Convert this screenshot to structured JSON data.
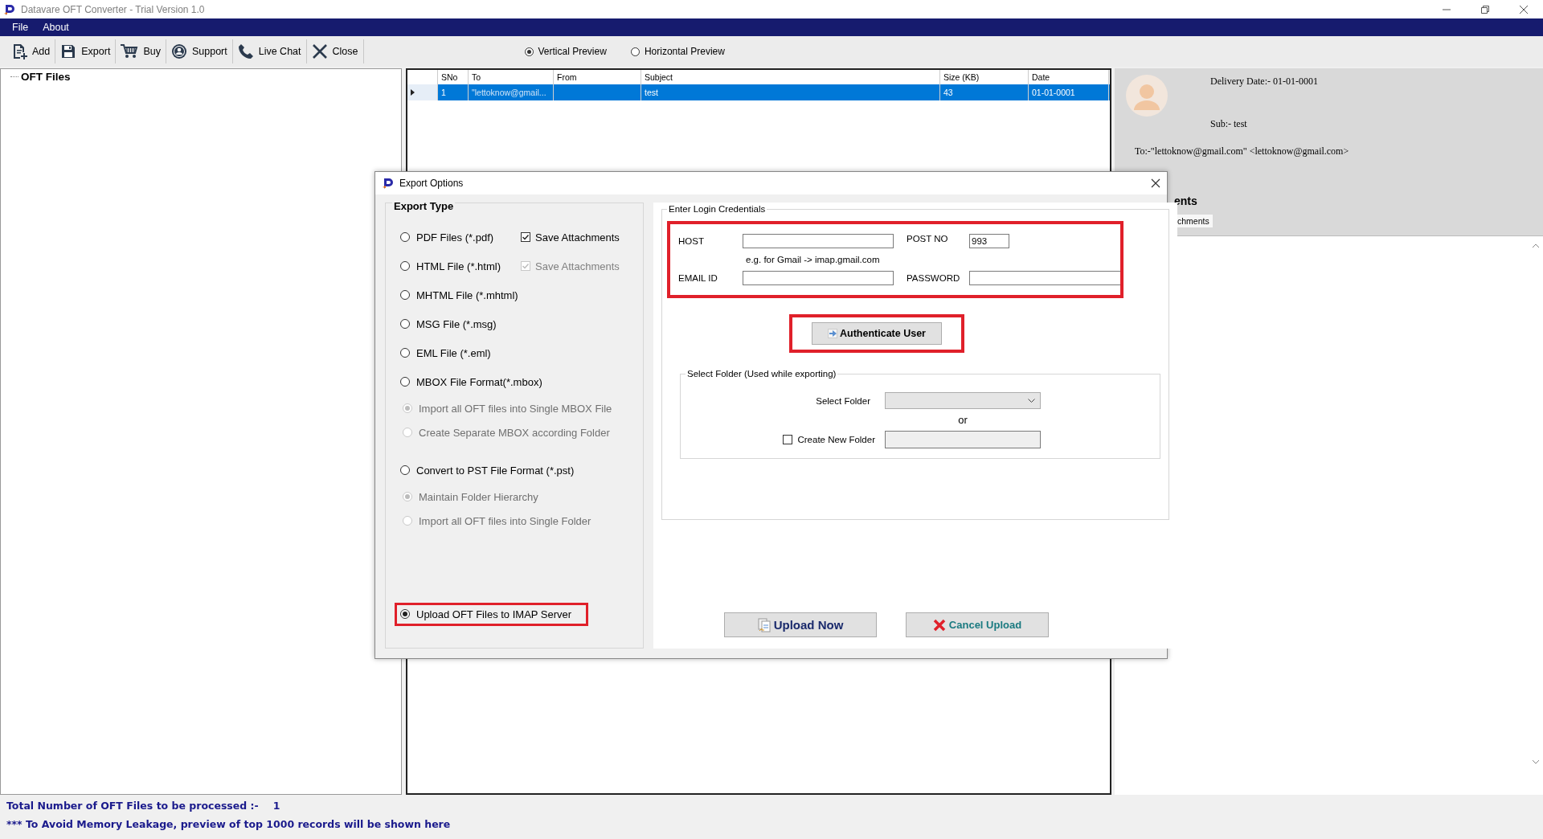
{
  "window": {
    "title": "Datavare OFT Converter - Trial Version 1.0"
  },
  "menu": [
    "File",
    "About"
  ],
  "toolbar": [
    {
      "label": "Add"
    },
    {
      "label": "Export"
    },
    {
      "label": "Buy"
    },
    {
      "label": "Support"
    },
    {
      "label": "Live Chat"
    },
    {
      "label": "Close"
    }
  ],
  "preview_mode": [
    {
      "label": "Vertical Preview",
      "selected": true
    },
    {
      "label": "Horizontal Preview",
      "selected": false
    }
  ],
  "tree": {
    "root": "OFT Files"
  },
  "grid": {
    "columns": [
      "SNo",
      "To",
      "From",
      "Subject",
      "Size (KB)",
      "Date"
    ],
    "rows": [
      {
        "selected": true,
        "sno": "1",
        "to": "\"lettoknow@gmail...",
        "subject": "test",
        "size": "43",
        "date": "01-01-0001"
      }
    ]
  },
  "preview": {
    "delivery_date": "Delivery Date:- 01-01-0001",
    "subject": "Sub:- test",
    "to": "To:-\"lettoknow@gmail.com\" <lettoknow@gmail.com>",
    "attachments_label": "ents",
    "attachments_tab": "chments"
  },
  "dialog": {
    "title": "Export Options",
    "export_type": {
      "title": "Export Type",
      "options": [
        {
          "kind": "radio",
          "label": "PDF Files (*.pdf)",
          "selected": false,
          "extra": {
            "label": "Save Attachments",
            "checked": true,
            "disabled": false
          }
        },
        {
          "kind": "radio",
          "label": "HTML File  (*.html)",
          "selected": false,
          "extra": {
            "label": "Save Attachments",
            "checked": true,
            "disabled": true
          }
        },
        {
          "kind": "radio",
          "label": "MHTML File  (*.mhtml)",
          "selected": false
        },
        {
          "kind": "radio",
          "label": "MSG File (*.msg)",
          "selected": false
        },
        {
          "kind": "radio",
          "label": "EML File (*.eml)",
          "selected": false
        },
        {
          "kind": "radio",
          "label": "MBOX File Format(*.mbox)",
          "selected": false
        },
        {
          "kind": "sub",
          "label": "Import all OFT files into Single MBOX File",
          "selected": true,
          "disabled": true
        },
        {
          "kind": "sub",
          "label": "Create Separate MBOX according Folder",
          "selected": false,
          "disabled": true
        },
        {
          "kind": "radio",
          "label": "Convert to PST File Format (*.pst)",
          "selected": false
        },
        {
          "kind": "sub",
          "label": "Maintain Folder Hierarchy",
          "selected": true,
          "disabled": true
        },
        {
          "kind": "sub",
          "label": "Import all OFT files into Single Folder",
          "selected": false,
          "disabled": true
        },
        {
          "kind": "radio",
          "label": "Upload OFT Files to IMAP Server",
          "selected": true,
          "highlighted": true
        }
      ]
    },
    "credentials": {
      "title": "Enter Login Credentials",
      "highlighted": true,
      "host_label": "HOST",
      "host_hint": "e.g. for Gmail -> imap.gmail.com",
      "port_label": "POST NO",
      "port_value": "993",
      "email_label": "EMAIL ID",
      "password_label": "PASSWORD"
    },
    "authenticate": {
      "label": "Authenticate User",
      "highlighted": true
    },
    "folder": {
      "title": "Select Folder (Used while exporting)",
      "select_label": "Select Folder",
      "or": "or",
      "create_label": "Create New Folder",
      "create_checked": false
    },
    "buttons": [
      {
        "kind": "upload",
        "label": "Upload Now"
      },
      {
        "kind": "cancel",
        "label": "Cancel Upload"
      }
    ]
  },
  "status": {
    "total_label": "Total Number of OFT Files to be processed :-",
    "total_value": "1",
    "note": "*** To Avoid Memory Leakage, preview of top 1000 records will be shown here"
  }
}
